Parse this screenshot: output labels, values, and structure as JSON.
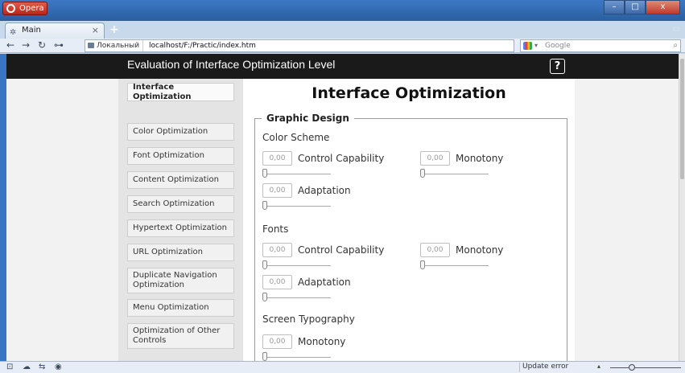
{
  "browser": {
    "menu_label": "Opera",
    "window_controls": {
      "minimize": "–",
      "maximize": "□",
      "close": "x"
    },
    "tab": {
      "title": "Main",
      "close": "×",
      "icon": "page-icon"
    },
    "newtab": "+",
    "tabstrip_right": "▭",
    "nav": {
      "back": "←",
      "forward": "→",
      "reload": "↻",
      "key": "⊶"
    },
    "address": {
      "site_label": "Локальный",
      "url": "localhost/F:/Practic/index.htm"
    },
    "search": {
      "placeholder": "Google",
      "caret": "▾",
      "icon": "⌕"
    }
  },
  "app": {
    "title": "Evaluation of Interface Optimization Level",
    "help_label": "?"
  },
  "sidebar": {
    "items": [
      {
        "label": "Interface Optimization",
        "active": true
      },
      {
        "label": "Color Optimization"
      },
      {
        "label": "Font Optimization"
      },
      {
        "label": "Content Optimization"
      },
      {
        "label": "Search Optimization"
      },
      {
        "label": "Hypertext Optimization"
      },
      {
        "label": "URL Optimization"
      },
      {
        "label": "Duplicate Navigation Optimization"
      },
      {
        "label": "Menu Optimization"
      },
      {
        "label": "Optimization of Other Controls"
      }
    ]
  },
  "main": {
    "title": "Interface Optimization",
    "group_legend": "Graphic Design",
    "sections": [
      {
        "title": "Color Scheme",
        "items": [
          {
            "value": "0,00",
            "label": "Control Capability",
            "level": 0
          },
          {
            "value": "0,00",
            "label": "Monotony",
            "level": 0
          },
          {
            "value": "0,00",
            "label": "Adaptation",
            "level": 0
          }
        ]
      },
      {
        "title": "Fonts",
        "items": [
          {
            "value": "0,00",
            "label": "Control Capability",
            "level": 0
          },
          {
            "value": "0,00",
            "label": "Monotony",
            "level": 0
          },
          {
            "value": "0,00",
            "label": "Adaptation",
            "level": 0
          }
        ]
      },
      {
        "title": "Screen Typography",
        "items": [
          {
            "value": "0,00",
            "label": "Monotony",
            "level": 0
          }
        ]
      }
    ]
  },
  "statusbar": {
    "icons": [
      "panel-icon",
      "cloud-icon",
      "share-icon",
      "turbo-icon"
    ],
    "glyphs": [
      "⊡",
      "☁",
      "⇆",
      "◉"
    ],
    "status_text": "Update error",
    "zoom_caret": "▴"
  }
}
